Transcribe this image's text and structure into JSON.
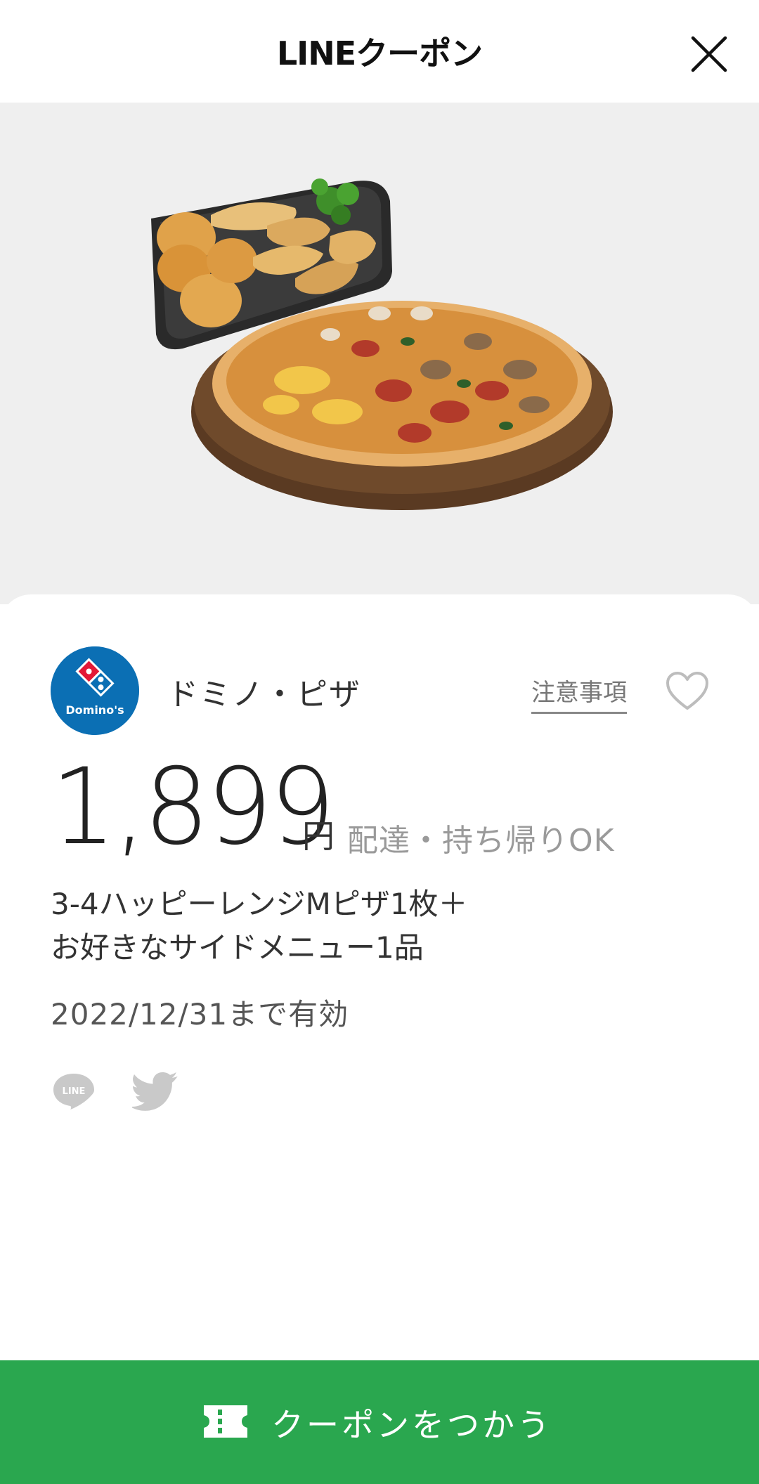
{
  "header": {
    "title": "LINEクーポン",
    "close_icon": "close-icon"
  },
  "hero": {
    "image": "pizza-and-side-menu-photo"
  },
  "shop": {
    "name": "ドミノ・ピザ",
    "logo_text": "Domino's",
    "notice_label": "注意事項",
    "favorite_icon": "heart-outline-icon"
  },
  "offer": {
    "price": "1,899",
    "unit": "円",
    "delivery": "配達・持ち帰りOK",
    "description_line1": "3-4ハッピーレンジMピザ1枚＋",
    "description_line2": "お好きなサイドメニュー1品",
    "validity": "2022/12/31まで有効"
  },
  "share": {
    "line_icon_text": "LINE",
    "twitter_icon": "twitter-icon"
  },
  "action": {
    "use_label": "クーポンをつかう",
    "ticket_icon": "ticket-icon"
  },
  "colors": {
    "accent_green": "#2aa74f",
    "brand_blue": "#0b6fb4",
    "brand_red": "#e31837",
    "hero_bg": "#efefef"
  }
}
